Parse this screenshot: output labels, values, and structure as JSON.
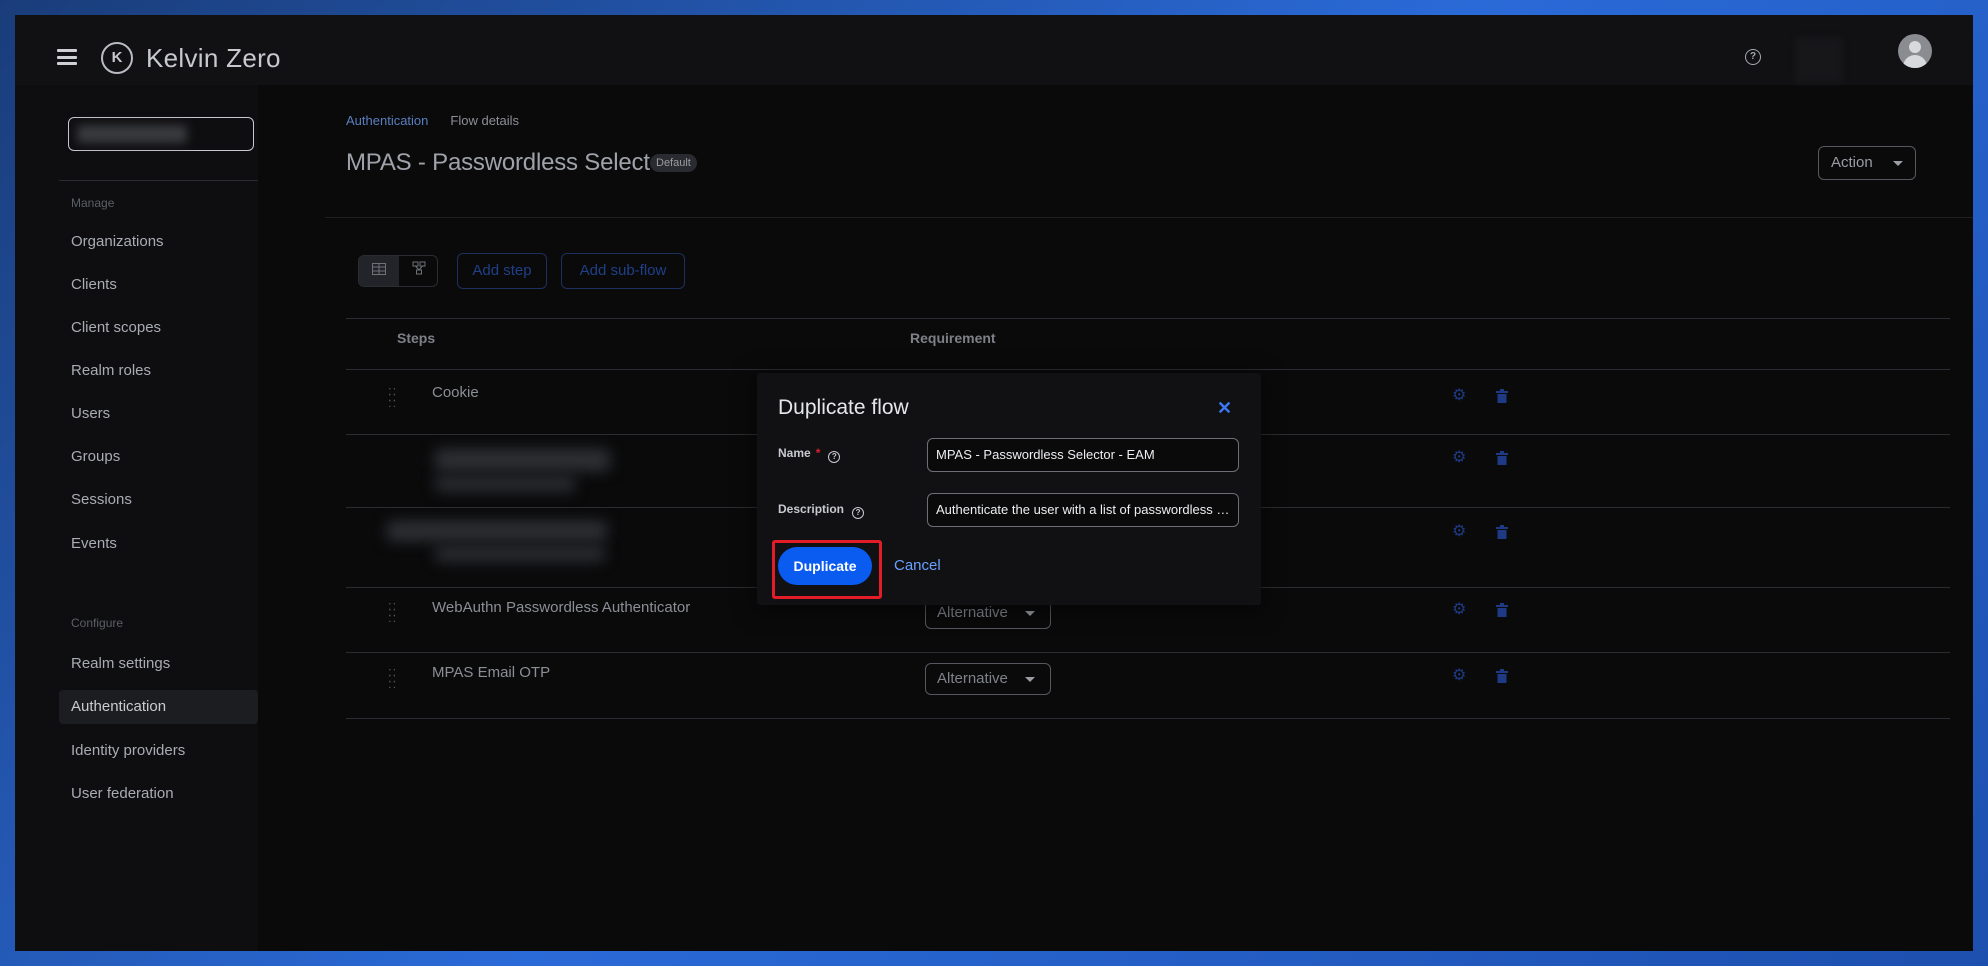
{
  "app": {
    "name": "Kelvin Zero",
    "logo_letter": "K"
  },
  "topbar": {
    "help_icon": "help-circle-icon",
    "avatar_icon": "user-avatar-icon"
  },
  "sidebar": {
    "manage_title": "Manage",
    "manage_items": [
      {
        "label": "Organizations"
      },
      {
        "label": "Clients"
      },
      {
        "label": "Client scopes"
      },
      {
        "label": "Realm roles"
      },
      {
        "label": "Users"
      },
      {
        "label": "Groups"
      },
      {
        "label": "Sessions"
      },
      {
        "label": "Events"
      }
    ],
    "configure_title": "Configure",
    "configure_items": [
      {
        "label": "Realm settings"
      },
      {
        "label": "Authentication",
        "active": true
      },
      {
        "label": "Identity providers"
      },
      {
        "label": "User federation"
      }
    ]
  },
  "breadcrumb": {
    "link": "Authentication",
    "current": "Flow details"
  },
  "page": {
    "title": "MPAS - Passwordless Selector",
    "badge": "Default",
    "action_label": "Action"
  },
  "toolbar": {
    "add_step": "Add step",
    "add_subflow": "Add sub-flow"
  },
  "table": {
    "columns": {
      "steps": "Steps",
      "requirement": "Requirement"
    },
    "rows": [
      {
        "name": "Cookie",
        "requirement": ""
      },
      {
        "name": "",
        "requirement": ""
      },
      {
        "name": "",
        "requirement": ""
      },
      {
        "name": "WebAuthn Passwordless Authenticator",
        "requirement": "Alternative"
      },
      {
        "name": "MPAS Email OTP",
        "requirement": "Alternative"
      }
    ]
  },
  "modal": {
    "title": "Duplicate flow",
    "name_label": "Name",
    "name_value": "MPAS - Passwordless Selector - EAM",
    "description_label": "Description",
    "description_value": "Authenticate the user with a list of passwordless options",
    "duplicate_label": "Duplicate",
    "cancel_label": "Cancel"
  },
  "colors": {
    "accent": "#0a5bf0",
    "highlight": "#e21d28",
    "background": "#0a0a0b"
  }
}
